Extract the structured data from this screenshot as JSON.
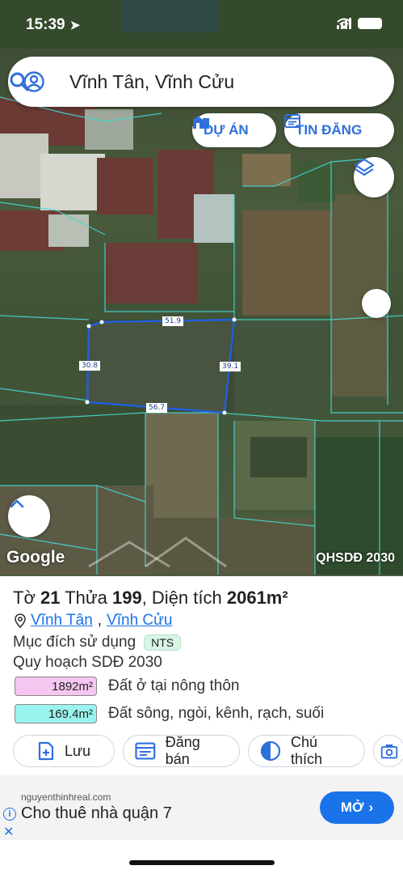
{
  "status_bar": {
    "time": "15:39"
  },
  "search": {
    "query": "Vĩnh Tân, Vĩnh Cửu"
  },
  "chips": {
    "du_an": "DỰ ÁN",
    "tin_dang": "TIN ĐĂNG"
  },
  "map": {
    "google_logo": "Google",
    "layer_label": "QHSDĐ 2030",
    "parcel_color": "#1f5fe0",
    "dimensions": {
      "top": "51.9",
      "left": "30.8",
      "right": "39.1",
      "bottom": "56.7"
    }
  },
  "parcel": {
    "title_prefix": "Tờ",
    "sheet": "21",
    "lot_prefix": "Thửa",
    "lot": "199",
    "area_prefix": ", Diện tích",
    "area": "2061m²",
    "ward": "Vĩnh Tân",
    "district": "Vĩnh Cửu",
    "purpose_label": "Mục đích sử dụng",
    "purpose_code": "NTS",
    "plan_label": "Quy hoạch SDĐ 2030",
    "plan_items": [
      {
        "area": "1892m²",
        "label": "Đất ở tại nông thôn",
        "color": "#f5c6f0"
      },
      {
        "area": "169.4m²",
        "label": "Đất sông, ngòi, kênh, rạch, suối",
        "color": "#9af3ee"
      }
    ]
  },
  "actions": {
    "save": "Lưu",
    "post_sale": "Đăng bán",
    "legend": "Chú thích"
  },
  "ad": {
    "domain": "nguyenthinhreal.com",
    "text": "Cho thuê nhà quận 7",
    "button": "MỞ"
  }
}
